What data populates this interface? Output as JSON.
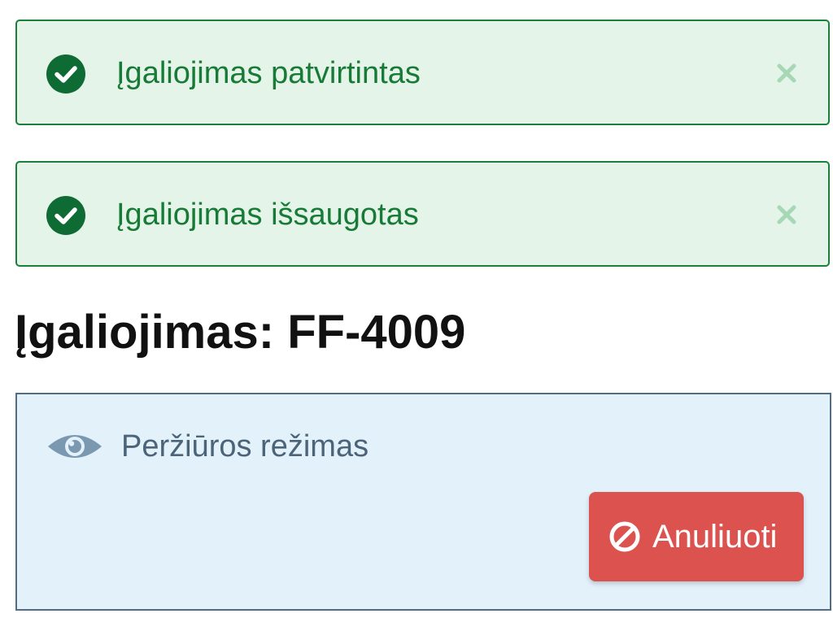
{
  "alerts": [
    {
      "icon": "check-circle-icon",
      "message": "Įgaliojimas patvirtintas",
      "close_icon": "close-icon"
    },
    {
      "icon": "check-circle-icon",
      "message": "Įgaliojimas išsaugotas",
      "close_icon": "close-icon"
    }
  ],
  "page": {
    "title": "Įgaliojimas: FF-4009"
  },
  "mode_panel": {
    "icon": "eye-icon",
    "label": "Peržiūros režimas",
    "cancel_button": {
      "icon": "ban-icon",
      "label": "Anuliuoti"
    }
  },
  "colors": {
    "success_bg": "#e4f4e8",
    "success_border": "#1b7f3b",
    "success_text": "#177a36",
    "info_bg": "#e3f1fb",
    "info_border": "#516e86",
    "info_text": "#4b6478",
    "danger": "#dc524f"
  }
}
